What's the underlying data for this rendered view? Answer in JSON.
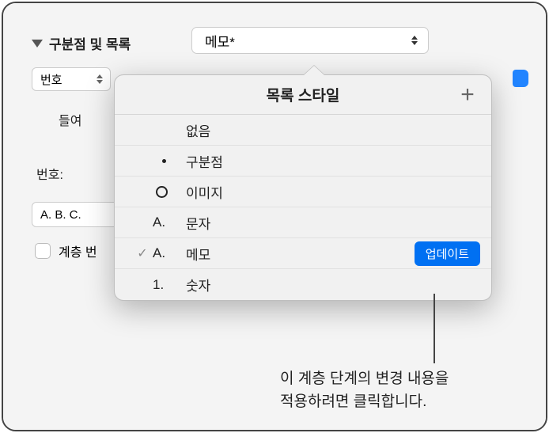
{
  "section": {
    "title": "구분점 및 목록"
  },
  "dropdown": {
    "current": "메모*"
  },
  "numberType": {
    "label": "번호"
  },
  "indent": {
    "label": "들여"
  },
  "numbering": {
    "label": "번호:"
  },
  "abcDisplay": "A. B. C.",
  "tierCheckbox": {
    "label": "계층 번"
  },
  "popover": {
    "title": "목록 스타일",
    "items": [
      {
        "preview": "",
        "label": "없음",
        "checked": false
      },
      {
        "preview": "bullet",
        "label": "구분점",
        "checked": false
      },
      {
        "preview": "circle",
        "label": "이미지",
        "checked": false
      },
      {
        "preview": "A.",
        "label": "문자",
        "checked": false
      },
      {
        "preview": "A.",
        "label": "메모",
        "checked": true,
        "update": true
      },
      {
        "preview": "1.",
        "label": "숫자",
        "checked": false
      }
    ],
    "updateLabel": "업데이트"
  },
  "callout": {
    "line1": "이 계층 단계의 변경 내용을",
    "line2": "적용하려면 클릭합니다."
  }
}
